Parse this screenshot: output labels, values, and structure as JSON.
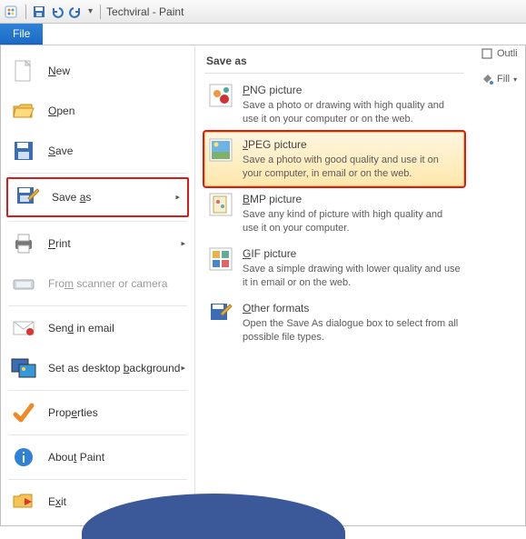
{
  "window": {
    "title": "Techviral - Paint"
  },
  "file_tab": {
    "label": "File"
  },
  "file_menu": {
    "new": "New",
    "open": "Open",
    "save": "Save",
    "save_as": "Save as",
    "print": "Print",
    "scanner": "From scanner or camera",
    "email": "Send in email",
    "desktop": "Set as desktop background",
    "properties": "Properties",
    "about": "About Paint",
    "exit": "Exit"
  },
  "saveas": {
    "title": "Save as",
    "png": {
      "title": "PNG picture",
      "desc": "Save a photo or drawing with high quality and use it on your computer or on the web."
    },
    "jpeg": {
      "title": "JPEG picture",
      "desc": "Save a photo with good quality and use it on your computer, in email or on the web."
    },
    "bmp": {
      "title": "BMP picture",
      "desc": "Save any kind of picture with high quality and use it on your computer."
    },
    "gif": {
      "title": "GIF picture",
      "desc": "Save a simple drawing with lower quality and use it in email or on the web."
    },
    "other": {
      "title": "Other formats",
      "desc": "Open the Save As dialogue box to select from all possible file types."
    }
  },
  "right_pane": {
    "outline": "Outli",
    "fill": "Fill"
  }
}
